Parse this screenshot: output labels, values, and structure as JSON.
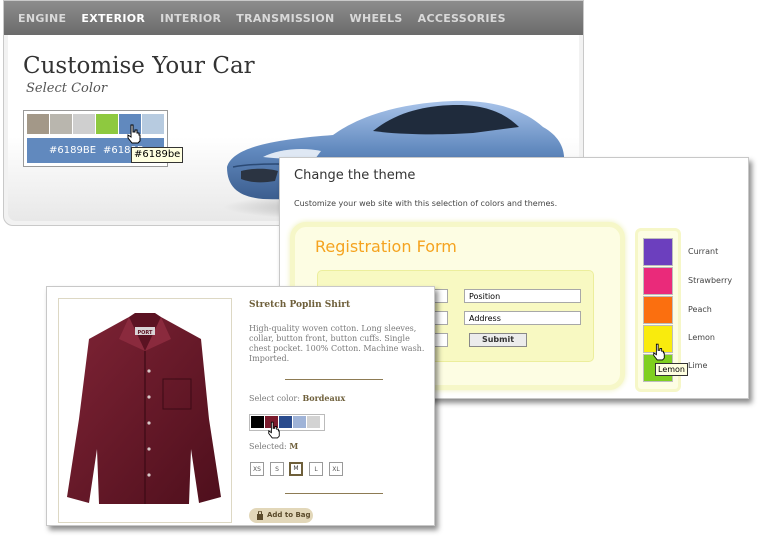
{
  "car": {
    "nav": [
      "ENGINE",
      "EXTERIOR",
      "INTERIOR",
      "TRANSMISSION",
      "WHEELS",
      "ACCESSORIES"
    ],
    "active_nav": "EXTERIOR",
    "title": "Customise Your Car",
    "subtitle": "Select Color",
    "swatches": [
      "#a39888",
      "#b9b6ae",
      "#cfcfcf",
      "#8ec93f",
      "#6189be",
      "#b7cbe0"
    ],
    "preview_text_1": "#6189BE",
    "preview_text_2": "#6189B",
    "tooltip": "#6189be",
    "car_color": "#6189be"
  },
  "theme": {
    "title": "Change the theme",
    "description": "Customize your web site with this selection of colors and themes.",
    "form_title": "Registration Form",
    "fields": [
      "Position",
      "Address"
    ],
    "submit_label": "Submit",
    "themes": [
      {
        "name": "Currant",
        "color": "#6c3fbe"
      },
      {
        "name": "Strawberry",
        "color": "#ea2a7a"
      },
      {
        "name": "Peach",
        "color": "#fb6f0f"
      },
      {
        "name": "Lemon",
        "color": "#f9eb0d"
      },
      {
        "name": "Lime",
        "color": "#7fcf1f"
      }
    ],
    "tooltip": "Lemon"
  },
  "shirt": {
    "name": "Stretch Poplin Shirt",
    "description": "High-quality woven cotton. Long sleeves, collar, button front, button cuffs. Single chest pocket. 100% Cotton. Machine wash. Imported.",
    "color_label": "Select color:",
    "color_value": "Bordeaux",
    "swatches": [
      "#000000",
      "#7a1a2c",
      "#2a4b8d",
      "#9fb3d7",
      "#d3d3d3"
    ],
    "selected_label": "Selected:",
    "selected_value": "M",
    "sizes": [
      "XS",
      "S",
      "M",
      "L",
      "XL"
    ],
    "selected_size": "M",
    "add_to_bag": "Add to Bag",
    "brand_tag": "PORT"
  }
}
